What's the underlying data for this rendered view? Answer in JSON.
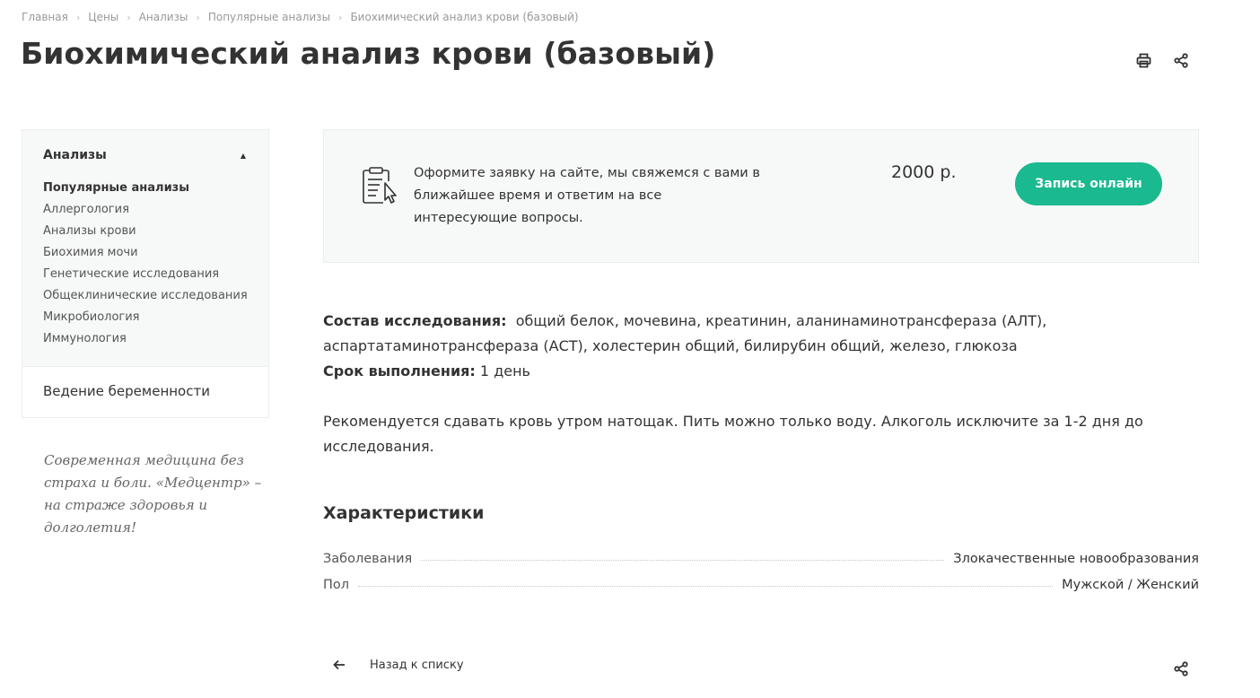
{
  "breadcrumbs": [
    "Главная",
    "Цены",
    "Анализы",
    "Популярные анализы",
    "Биохимический анализ крови (базовый)"
  ],
  "page_title": "Биохимический анализ крови (базовый)",
  "icons": {
    "print": "printer-icon",
    "share": "share-icon",
    "clipboard": "clipboard-cursor-icon",
    "back": "arrow-left-icon"
  },
  "sidebar": {
    "section_title": "Анализы",
    "items": [
      {
        "label": "Популярные анализы",
        "active": true
      },
      {
        "label": "Аллергология",
        "active": false
      },
      {
        "label": "Анализы крови",
        "active": false
      },
      {
        "label": "Биохимия мочи",
        "active": false
      },
      {
        "label": "Генетические исследования",
        "active": false
      },
      {
        "label": "Общеклинические исследования",
        "active": false
      },
      {
        "label": "Микробиология",
        "active": false
      },
      {
        "label": "Иммунология",
        "active": false
      }
    ],
    "extra_item": "Ведение беременности"
  },
  "slogan": "Современная медицина без страха и боли. «Медцентр» – на страже здоровья и долголетия!",
  "cta": {
    "text": "Оформите заявку на сайте, мы свяжемся с вами в ближайшее время и ответим на все интересующие вопросы.",
    "price": "2000 р.",
    "button_label": "Запись онлайн"
  },
  "details": {
    "composition_label": "Состав исследования:",
    "composition_value": "общий белок, мочевина, креатинин, аланинаминотрансфераза (АЛТ), аспартатаминотрансфераза (АСТ), холестерин общий, билирубин общий, железо, глюкоза",
    "duration_label": "Срок выполнения:",
    "duration_value": "1 день",
    "recommendation": "Рекомендуется сдавать кровь утром натощак. Пить можно только воду. Алкоголь исключите за 1-2 дня до исследования."
  },
  "characteristics": {
    "title": "Характеристики",
    "rows": [
      {
        "name": "Заболевания",
        "value": "Злокачественные новообразования"
      },
      {
        "name": "Пол",
        "value": "Мужской / Женский"
      }
    ]
  },
  "footer": {
    "back_label": "Назад к списку"
  },
  "colors": {
    "accent": "#1bb98f",
    "panel": "#f7f8f8",
    "text": "#333333"
  }
}
